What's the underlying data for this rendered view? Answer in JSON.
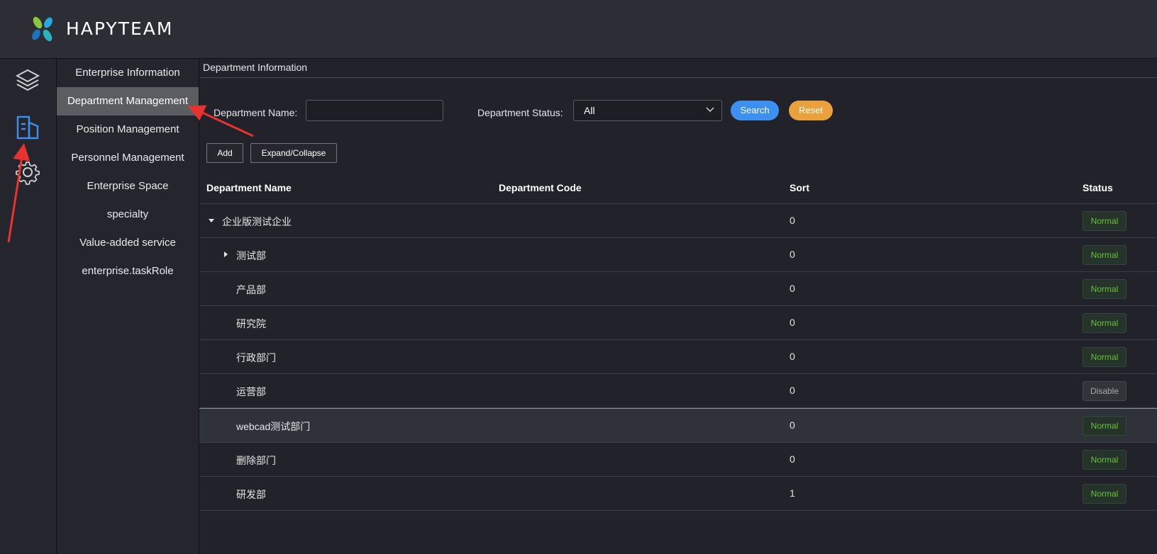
{
  "app": {
    "brand": "HAPYTEAM"
  },
  "iconbar": {
    "items": [
      {
        "icon": "layers-icon"
      },
      {
        "icon": "building-icon",
        "active": true,
        "accent": "#3d8ff0"
      },
      {
        "icon": "gear-icon"
      }
    ]
  },
  "submenu": {
    "items": [
      {
        "label": "Enterprise Information"
      },
      {
        "label": "Department Management",
        "active": true
      },
      {
        "label": "Position Management"
      },
      {
        "label": "Personnel Management"
      },
      {
        "label": "Enterprise Space"
      },
      {
        "label": "specialty"
      },
      {
        "label": "Value-added service"
      },
      {
        "label": "enterprise.taskRole"
      }
    ]
  },
  "main": {
    "breadcrumb": "Department Information",
    "filters": {
      "name_label": "Department Name:",
      "name_value": "",
      "status_label": "Department Status:",
      "status_value": "All",
      "search_label": "Search",
      "reset_label": "Reset"
    },
    "toolbar": {
      "add_label": "Add",
      "expand_label": "Expand/Collapse"
    },
    "table": {
      "headers": [
        "Department Name",
        "Department Code",
        "Sort",
        "Status"
      ],
      "rows": [
        {
          "name": "企业版测试企业",
          "code": "",
          "sort": "0",
          "status": "Normal",
          "level": 0,
          "caret": "expanded"
        },
        {
          "name": "测试部",
          "code": "",
          "sort": "0",
          "status": "Normal",
          "level": 1,
          "caret": "collapsed"
        },
        {
          "name": "产品部",
          "code": "",
          "sort": "0",
          "status": "Normal",
          "level": 1
        },
        {
          "name": "研究院",
          "code": "",
          "sort": "0",
          "status": "Normal",
          "level": 1
        },
        {
          "name": "行政部门",
          "code": "",
          "sort": "0",
          "status": "Normal",
          "level": 1
        },
        {
          "name": "运营部",
          "code": "",
          "sort": "0",
          "status": "Disable",
          "level": 1
        },
        {
          "name": "webcad测试部门",
          "code": "",
          "sort": "0",
          "status": "Normal",
          "level": 1,
          "highlight": true
        },
        {
          "name": "删除部门",
          "code": "",
          "sort": "0",
          "status": "Normal",
          "level": 1
        },
        {
          "name": "研发部",
          "code": "",
          "sort": "1",
          "status": "Normal",
          "level": 1
        }
      ]
    }
  },
  "colors": {
    "accent_blue": "#3d8ff0",
    "reset_orange": "#e9a23b",
    "normal_green": "#67c23a",
    "annotation_red": "#e8322f"
  }
}
